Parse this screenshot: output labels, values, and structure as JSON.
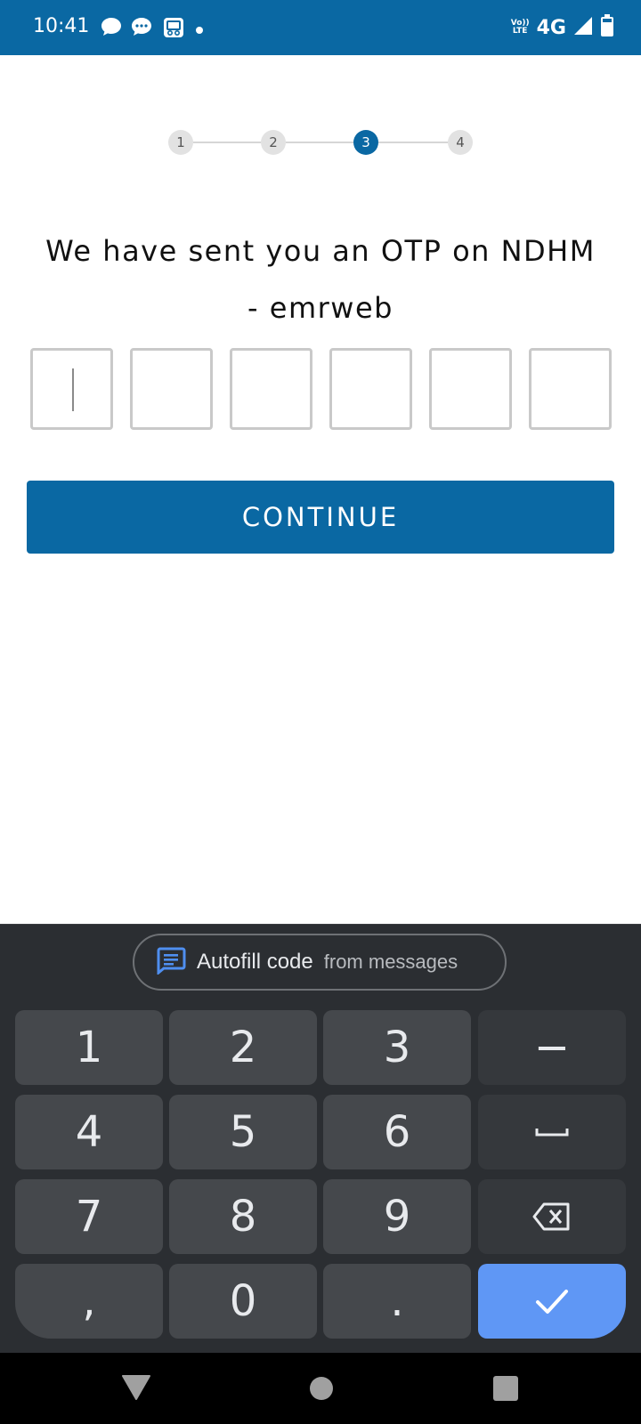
{
  "status_bar": {
    "time": "10:41",
    "network": "4G",
    "volte_top": "Vo))",
    "volte_bottom": "LTE",
    "background": "#0a68a3"
  },
  "stepper": {
    "steps": [
      "1",
      "2",
      "3",
      "4"
    ],
    "active_step": "3"
  },
  "otp": {
    "heading": "We have sent you an OTP on NDHM - emrweb",
    "digit_count": 6
  },
  "continue_button": {
    "label": "CONTINUE",
    "color": "#0a68a3"
  },
  "keyboard": {
    "autofill": {
      "icon": "message-icon",
      "label": "Autofill code",
      "sublabel": "from messages"
    },
    "keys": {
      "k1": "1",
      "k2": "2",
      "k3": "3",
      "dash": "−",
      "k4": "4",
      "k5": "5",
      "k6": "6",
      "space": "␣",
      "k7": "7",
      "k8": "8",
      "k9": "9",
      "backspace": "backspace-icon",
      "comma": ",",
      "k0": "0",
      "period": ".",
      "done": "checkmark-icon"
    },
    "done_color": "#5f97f5"
  },
  "nav_bar": {
    "back": "back-triangle-icon",
    "home": "home-circle-icon",
    "recents": "recents-square-icon"
  }
}
